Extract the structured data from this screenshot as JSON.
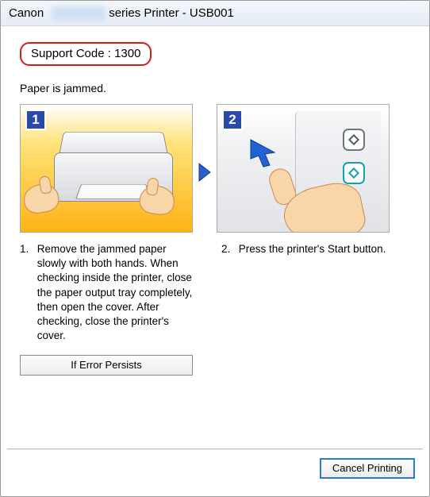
{
  "window": {
    "title_prefix": "Canon",
    "title_suffix": "series Printer - USB001"
  },
  "support_code": {
    "label": "Support Code :",
    "value": "1300"
  },
  "status": {
    "text": "Paper is jammed."
  },
  "steps": {
    "step1": {
      "num": "1"
    },
    "step2": {
      "num": "2"
    }
  },
  "instructions": {
    "item1_num": "1.",
    "item1_text": "Remove the jammed paper slowly with both hands. When checking inside the printer, close the paper output tray completely, then open the cover. After checking, close the printer's cover.",
    "item2_num": "2.",
    "item2_text": "Press the printer's Start button."
  },
  "buttons": {
    "if_error_persists": "If Error Persists",
    "cancel_printing": "Cancel Printing"
  }
}
